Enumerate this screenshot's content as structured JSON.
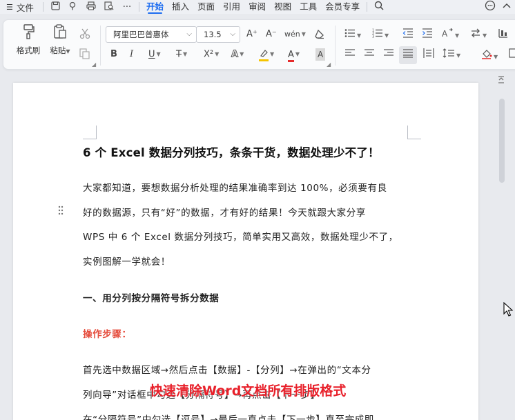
{
  "menubar": {
    "file_label": "文件",
    "tabs": [
      {
        "label": "开始",
        "active": true
      },
      {
        "label": "插入",
        "active": false
      },
      {
        "label": "页面",
        "active": false
      },
      {
        "label": "引用",
        "active": false
      },
      {
        "label": "审阅",
        "active": false
      },
      {
        "label": "视图",
        "active": false
      },
      {
        "label": "工具",
        "active": false
      },
      {
        "label": "会员专享",
        "active": false
      }
    ],
    "more_glyph": "···"
  },
  "ribbon": {
    "format_painter_label": "格式刷",
    "paste_label": "粘贴",
    "font_name": "阿里巴巴普惠体",
    "font_size": "13.5",
    "bold": "B",
    "italic": "I",
    "underline": "U",
    "strike": "T",
    "superscript": "X²",
    "text_effect": "A",
    "highlight": "A",
    "font_color": "A",
    "char_shade": "A",
    "font_grow": "A⁺",
    "font_shrink": "A⁻",
    "pinyin": "wén"
  },
  "colors": {
    "accent": "#1c6cf0",
    "red_heading": "#e54c3c",
    "overlay_red": "#e8202a",
    "highlight_yellow": "#f5c400",
    "font_color_red": "#e52b2b"
  },
  "document": {
    "title": "6 个 Excel 数据分列技巧，条条干货，数据处理少不了！",
    "para1": [
      "大家都知道，要想数据分析处理的结果准确率到达 100%，必须要有良",
      "好的数据源，只有“好”的数据，才有好的结果！今天就跟大家分享",
      "WPS 中 6 个 Excel 数据分列技巧，简单实用又高效，数据处理少不了，",
      "实例图解一学就会！"
    ],
    "heading1": "一、用分列按分隔符号拆分数据",
    "steps_label": "操作步骤：",
    "para2": [
      "首先选中数据区域→然后点击【数据】-【分列】→在弹出的“文本分",
      "列向导”对话框中勾选【分隔符号】→再点击【下一步】",
      "在“分隔符号”中勾选【逗号】→最后一直点击【下一步】直至完成即"
    ]
  },
  "overlay_caption": "快速清除Word文档所有排版格式"
}
